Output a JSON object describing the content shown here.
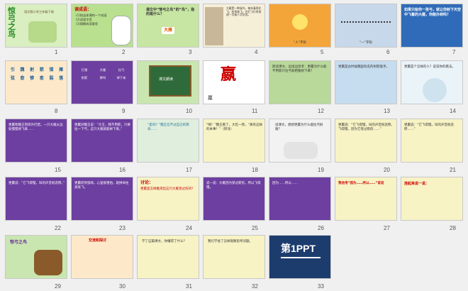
{
  "slides": [
    {
      "n": "1",
      "title": "惊弓之鸟",
      "sub": "语文版小学三年级下册"
    },
    {
      "n": "2",
      "heading": "读成语：",
      "lines": [
        "(1)找出本课的一个成语",
        "(2)读准字音",
        "(3)理解成语意思"
      ]
    },
    {
      "n": "3",
      "q": "课文中“惊弓之鸟”的“鸟”，指的是什么？",
      "ans": "大雁"
    },
    {
      "n": "4",
      "text": "大雁是一种候鸟，每年春季北飞，秋季南飞，它们飞行时排成一字或人字队形。"
    },
    {
      "n": "5",
      "cap": "“人”字形"
    },
    {
      "n": "6",
      "cap": "“一”字形"
    },
    {
      "n": "7",
      "q": "如果只给你一张弓，就让你射下天空中飞着的大雁，你能办到吗？"
    },
    {
      "n": "8",
      "cells": [
        "引",
        "魏",
        "射",
        "箭",
        "猎",
        "雁",
        "弦",
        "愈",
        "惨",
        "愈",
        "裂",
        "落"
      ]
    },
    {
      "n": "9",
      "words": [
        "打猎",
        "大雁",
        "拉弓",
        "射箭",
        "惨叫",
        "掉下来"
      ]
    },
    {
      "n": "10",
      "title": "课文朗读"
    },
    {
      "n": "11",
      "char": "嬴",
      "char2": "羸"
    },
    {
      "n": "12",
      "text": "默读课文，边读边思考：更羸为什么能不用箭只拉弓就把雁射下来？"
    },
    {
      "n": "13",
      "text": "更羸是古时候魏国有名的射箭能手。"
    },
    {
      "n": "14",
      "text": "更羸是个怎样的人？说说你的看法。"
    },
    {
      "n": "15",
      "text": "更羸和魏王到郊外打猎，一只大雁从远处慢慢地飞来……"
    },
    {
      "n": "16",
      "text": "更羸对魏王说：“大王，我不用箭，只要拉一下弓，这只大雁就能掉下来。”"
    },
    {
      "n": "17",
      "text": "“是吗？”魏王信不过自己的耳朵……"
    },
    {
      "n": "18",
      "text": "“啊！”魏王看了，大吃一惊，“真有这样的本事！”（惊讶）"
    },
    {
      "n": "19",
      "text": "读课文，想想更羸为什么能拉弓射雁？"
    },
    {
      "n": "20",
      "text": "更羸说：“它飞得慢，叫的声音很悲惨。飞得慢，因为它受过箭伤……”"
    },
    {
      "n": "21",
      "text": "更羸说：“它飞得慢，叫的声音很悲惨……”"
    },
    {
      "n": "22",
      "text": "更羸说：“它飞得慢，叫的声音很悲惨。”"
    },
    {
      "n": "23",
      "text": "更羸听到弦响，心里很害怕，就拼命往高处飞。"
    },
    {
      "n": "24",
      "heading": "讨论：",
      "text": "更羸是怎样推测出这只大雁受过伤的？"
    },
    {
      "n": "25",
      "text": "说一说：大雁因为受过箭伤，所以飞得慢。"
    },
    {
      "n": "26",
      "text": "因为……所以……"
    },
    {
      "n": "27",
      "heading": "我会用“因为……所以……”说话"
    },
    {
      "n": "28",
      "heading": "连起来说一说："
    },
    {
      "n": "29",
      "text": "惊弓之鸟"
    },
    {
      "n": "30",
      "heading": "交流和探讨"
    },
    {
      "n": "31",
      "text": "学了这篇课文，你懂得了什么？"
    },
    {
      "n": "32",
      "text": "我们学会了怎样观察思考问题。"
    },
    {
      "n": "33",
      "logo": "第1PPT"
    }
  ]
}
